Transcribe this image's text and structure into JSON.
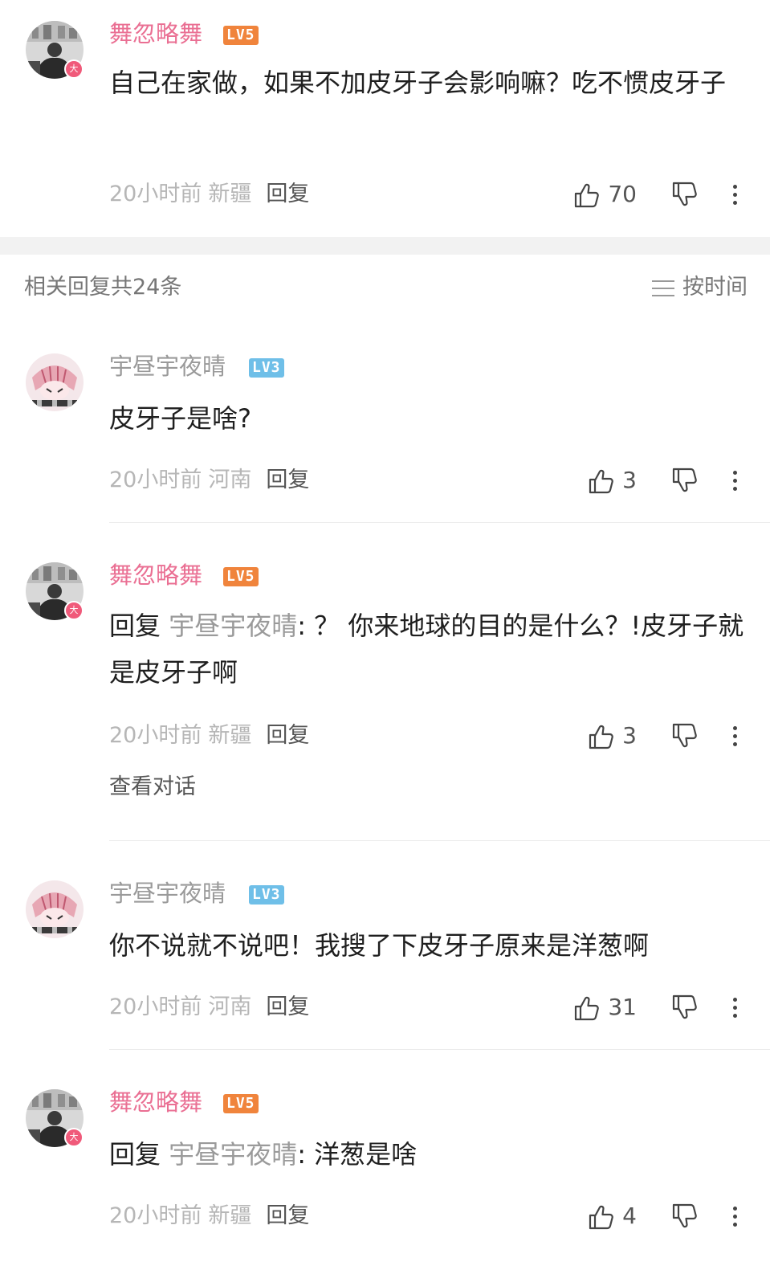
{
  "top_comment": {
    "username": "舞忽略舞",
    "level": "LV5",
    "vip_badge": "大",
    "text": "自己在家做，如果不加皮牙子会影响嘛？吃不惯皮牙子",
    "time": "20小时前",
    "location": "新疆",
    "reply_label": "回复",
    "likes": "70"
  },
  "replies_header": {
    "count_label": "相关回复共24条",
    "sort_label": "按时间"
  },
  "replies": [
    {
      "username": "宇昼宇夜晴",
      "level": "LV3",
      "text": "皮牙子是啥?",
      "time": "20小时前",
      "location": "河南",
      "reply_label": "回复",
      "likes": "3"
    },
    {
      "username": "舞忽略舞",
      "level": "LV5",
      "vip_badge": "大",
      "reply_prefix": "回复 ",
      "mention": "宇昼宇夜晴",
      "text": ": ？ 你来地球的目的是什么？!皮牙子就是皮牙子啊",
      "time": "20小时前",
      "location": "新疆",
      "reply_label": "回复",
      "likes": "3",
      "view_conversation": "查看对话"
    },
    {
      "username": "宇昼宇夜晴",
      "level": "LV3",
      "text": "你不说就不说吧！我搜了下皮牙子原来是洋葱啊",
      "time": "20小时前",
      "location": "河南",
      "reply_label": "回复",
      "likes": "31"
    },
    {
      "username": "舞忽略舞",
      "level": "LV5",
      "vip_badge": "大",
      "reply_prefix": "回复 ",
      "mention": "宇昼宇夜晴",
      "text": ": 洋葱是啥",
      "time": "20小时前",
      "location": "新疆",
      "reply_label": "回复",
      "likes": "4"
    }
  ],
  "colors": {
    "pink_username": "#ea6f93",
    "grey_username": "#9a9a9a",
    "level_orange": "#f0843c",
    "level_blue": "#6fbfe8",
    "vip_badge": "#f05a7a"
  },
  "icons": {
    "like": "thumbs-up-icon",
    "dislike": "thumbs-down-icon",
    "more": "more-vertical-icon",
    "sort": "sort-lines-icon"
  }
}
